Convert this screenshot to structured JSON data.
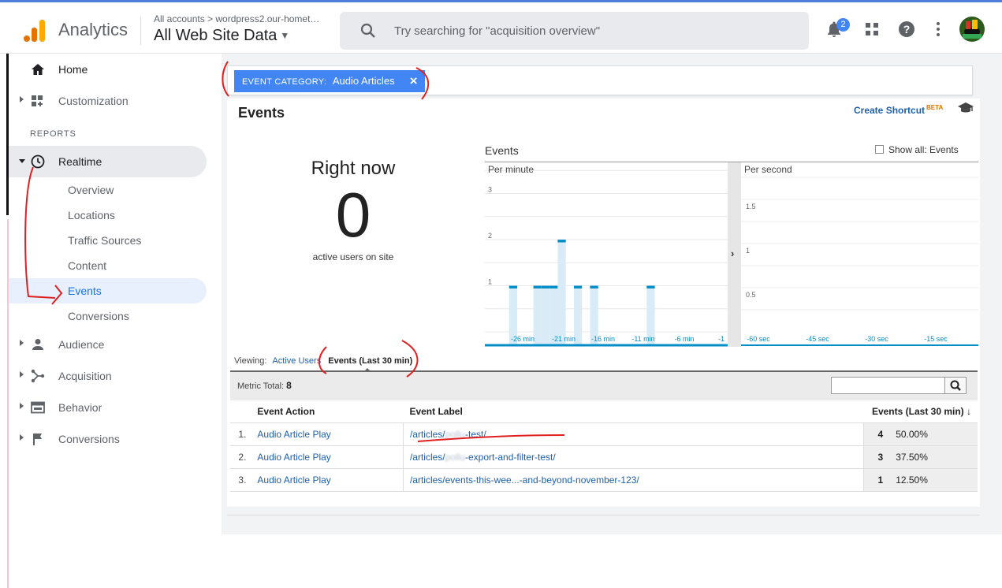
{
  "app": {
    "name": "Analytics"
  },
  "account": {
    "breadcrumb": "All accounts > wordpress2.our-homet…",
    "view": "All Web Site Data"
  },
  "search": {
    "placeholder": "Try searching for \"acquisition overview\""
  },
  "header": {
    "notification_count": "2"
  },
  "sidebar": {
    "home": "Home",
    "customization": "Customization",
    "section": "REPORTS",
    "realtime": "Realtime",
    "realtime_items": [
      "Overview",
      "Locations",
      "Traffic Sources",
      "Content",
      "Events",
      "Conversions"
    ],
    "audience": "Audience",
    "acquisition": "Acquisition",
    "behavior": "Behavior",
    "conversions": "Conversions"
  },
  "filter": {
    "key": "EVENT CATEGORY:",
    "value": "Audio Articles"
  },
  "panel": {
    "title": "Events",
    "shortcut": "Create Shortcut",
    "shortcut_badge": "BETA"
  },
  "rightnow": {
    "label": "Right now",
    "value": "0",
    "sub": "active users on site"
  },
  "chart": {
    "title": "Events",
    "show_all": "Show all: Events",
    "per_minute": "Per minute",
    "per_second": "Per second",
    "expand": "›",
    "minute_yticks": [
      "1",
      "2",
      "3"
    ],
    "minute_xticks": [
      "-26 min",
      "-21 min",
      "-16 min",
      "-11 min",
      "-6 min",
      "-1"
    ],
    "second_yticks": [
      "0.5",
      "1",
      "1.5"
    ],
    "second_xticks": [
      "-60 sec",
      "-45 sec",
      "-30 sec",
      "-15 sec"
    ],
    "accent": "#058dc7"
  },
  "viewing": {
    "label": "Viewing:",
    "option1": "Active Users",
    "option2": "Events (Last 30 min)"
  },
  "metric": {
    "label": "Metric Total:",
    "value": "8"
  },
  "table": {
    "headers": [
      "Event Action",
      "Event Label",
      "Events (Last 30 min)"
    ],
    "rows": [
      {
        "idx": "1.",
        "action": "Audio Article Play",
        "label_pre": "/articles/",
        "label_blur": "pollu",
        "label_post": "-test/",
        "count": "4",
        "pct": "50.00%"
      },
      {
        "idx": "2.",
        "action": "Audio Article Play",
        "label_pre": "/articles/",
        "label_blur": "pollu",
        "label_post": "-export-and-filter-test/",
        "count": "3",
        "pct": "37.50%"
      },
      {
        "idx": "3.",
        "action": "Audio Article Play",
        "label_pre": "/articles/events-this-wee...-and-beyond-november-123/",
        "label_blur": "",
        "label_post": "",
        "count": "1",
        "pct": "12.50%"
      }
    ]
  },
  "chart_data": {
    "type": "bar",
    "title": "Events",
    "subtitle": "Per minute",
    "categories": [
      "-30 min",
      "-29 min",
      "-28 min",
      "-27 min",
      "-26 min",
      "-25 min",
      "-24 min",
      "-23 min",
      "-22 min",
      "-21 min",
      "-20 min",
      "-19 min",
      "-18 min",
      "-17 min",
      "-16 min",
      "-15 min",
      "-14 min",
      "-13 min",
      "-12 min",
      "-11 min",
      "-10 min",
      "-9 min",
      "-8 min",
      "-7 min",
      "-6 min",
      "-5 min",
      "-4 min",
      "-3 min",
      "-2 min",
      "-1 min"
    ],
    "values": [
      0,
      0,
      0,
      1,
      0,
      0,
      1,
      1,
      1,
      2,
      0,
      1,
      0,
      1,
      0,
      0,
      0,
      0,
      0,
      0,
      1,
      0,
      0,
      0,
      0,
      0,
      0,
      0,
      0,
      0
    ],
    "ylim": [
      0,
      3
    ],
    "grid": true
  }
}
